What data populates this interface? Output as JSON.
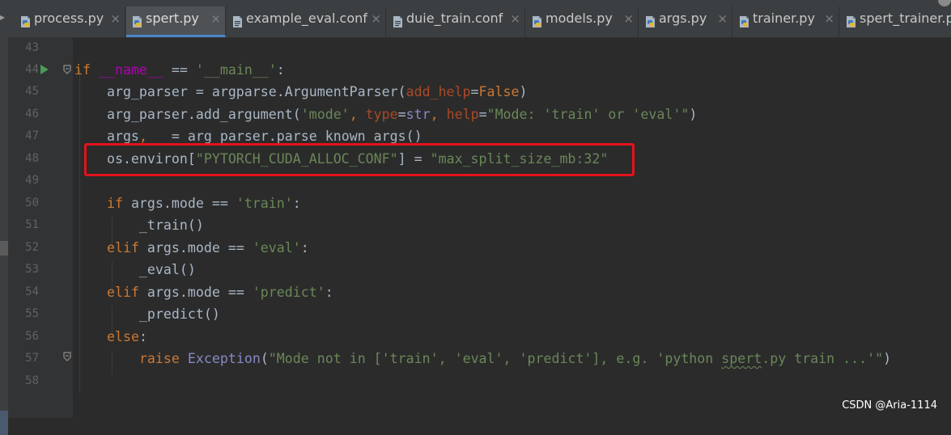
{
  "tabs": [
    {
      "label": "process.py",
      "icon": "python-file-icon",
      "active": false
    },
    {
      "label": "spert.py",
      "icon": "python-file-icon",
      "active": true
    },
    {
      "label": "example_eval.conf",
      "icon": "text-file-icon",
      "active": false
    },
    {
      "label": "duie_train.conf",
      "icon": "text-file-icon",
      "active": false
    },
    {
      "label": "models.py",
      "icon": "python-file-icon",
      "active": false
    },
    {
      "label": "args.py",
      "icon": "python-file-icon",
      "active": false
    },
    {
      "label": "trainer.py",
      "icon": "python-file-icon",
      "active": false
    },
    {
      "label": "spert_trainer.py",
      "icon": "python-file-icon",
      "active": false
    }
  ],
  "close_glyph": "×",
  "editor": {
    "line_numbers": [
      "43",
      "44",
      "45",
      "46",
      "47",
      "48",
      "49",
      "50",
      "51",
      "52",
      "53",
      "54",
      "55",
      "56",
      "57",
      "58"
    ],
    "lines": [
      {
        "parts": []
      },
      {
        "parts": [
          {
            "t": "if",
            "c": "kw"
          },
          {
            "t": " "
          },
          {
            "t": "__name__",
            "c": "dn"
          },
          {
            "t": " == "
          },
          {
            "t": "'__main__'",
            "c": "s"
          },
          {
            "t": ":"
          }
        ]
      },
      {
        "parts": [
          {
            "t": "    arg_parser = argparse.ArgumentParser("
          },
          {
            "t": "add_help",
            "c": "pm"
          },
          {
            "t": "="
          },
          {
            "t": "False",
            "c": "kw"
          },
          {
            "t": ")"
          }
        ]
      },
      {
        "parts": [
          {
            "t": "    arg_parser.add_argument("
          },
          {
            "t": "'mode'",
            "c": "s"
          },
          {
            "t": ", ",
            "c": "kw"
          },
          {
            "t": "type",
            "c": "pm"
          },
          {
            "t": "="
          },
          {
            "t": "str",
            "c": "bi"
          },
          {
            "t": ", ",
            "c": "kw"
          },
          {
            "t": "help",
            "c": "pm"
          },
          {
            "t": "="
          },
          {
            "t": "\"Mode: 'train' or 'eval'\"",
            "c": "s"
          },
          {
            "t": ")"
          }
        ]
      },
      {
        "parts": [
          {
            "t": "    args"
          },
          {
            "t": ", ",
            "c": "kw"
          },
          {
            "t": "_ = arg_parser.parse_known_args()"
          }
        ]
      },
      {
        "parts": [
          {
            "t": "    os.environ["
          },
          {
            "t": "\"PYTORCH_CUDA_ALLOC_CONF\"",
            "c": "s"
          },
          {
            "t": "] = "
          },
          {
            "t": "\"max_split_size_mb:32\"",
            "c": "s"
          }
        ]
      },
      {
        "parts": []
      },
      {
        "parts": [
          {
            "t": "    "
          },
          {
            "t": "if",
            "c": "kw"
          },
          {
            "t": " args.mode == "
          },
          {
            "t": "'train'",
            "c": "s"
          },
          {
            "t": ":"
          }
        ]
      },
      {
        "parts": [
          {
            "t": "        _train()"
          }
        ]
      },
      {
        "parts": [
          {
            "t": "    "
          },
          {
            "t": "elif",
            "c": "kw"
          },
          {
            "t": " args.mode == "
          },
          {
            "t": "'eval'",
            "c": "s"
          },
          {
            "t": ":"
          }
        ]
      },
      {
        "parts": [
          {
            "t": "        _eval()"
          }
        ]
      },
      {
        "parts": [
          {
            "t": "    "
          },
          {
            "t": "elif",
            "c": "kw"
          },
          {
            "t": " args.mode == "
          },
          {
            "t": "'predict'",
            "c": "s"
          },
          {
            "t": ":"
          }
        ]
      },
      {
        "parts": [
          {
            "t": "        _predict()"
          }
        ]
      },
      {
        "parts": [
          {
            "t": "    "
          },
          {
            "t": "else",
            "c": "kw"
          },
          {
            "t": ":"
          }
        ]
      },
      {
        "parts": [
          {
            "t": "        "
          },
          {
            "t": "raise",
            "c": "kw"
          },
          {
            "t": " "
          },
          {
            "t": "Exception",
            "c": "bi"
          },
          {
            "t": "("
          },
          {
            "t": "\"Mode not in ['train', 'eval', 'predict'], e.g. 'python ",
            "c": "s"
          },
          {
            "t": "spert",
            "c": "s typo"
          },
          {
            "t": ".py train ...'\"",
            "c": "s"
          },
          {
            "t": ")"
          }
        ]
      },
      {
        "parts": []
      }
    ]
  },
  "colors": {
    "keyword": "#cc7832",
    "string": "#6a8759",
    "param": "#aa4926",
    "dunder": "#b200b2",
    "builtin": "#8888c6",
    "highlight_box": "#e3131b"
  },
  "watermark": "CSDN @Aria-1114"
}
